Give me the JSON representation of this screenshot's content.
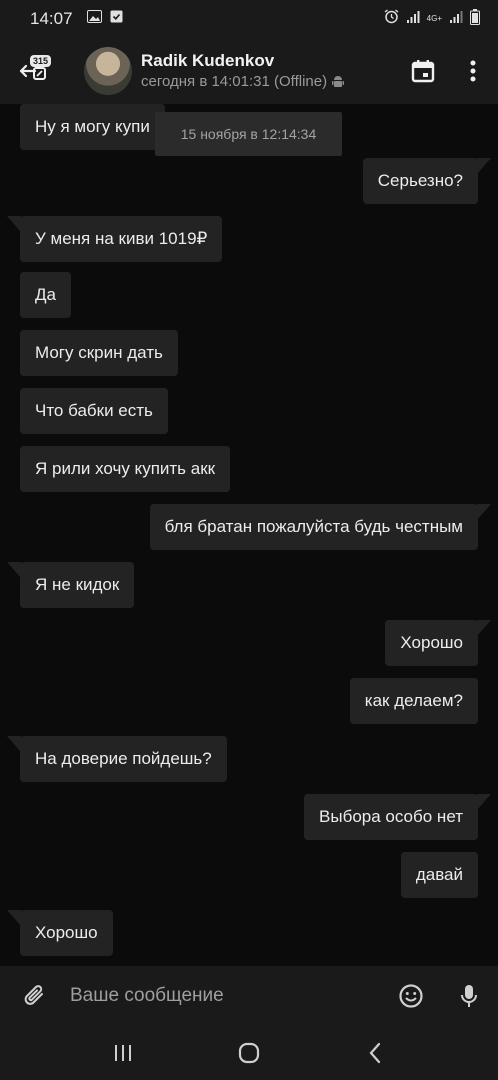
{
  "status_bar": {
    "time": "14:07",
    "network": "4G+"
  },
  "header": {
    "unread_count": "315",
    "contact_name": "Radik Kudenkov",
    "last_seen": "сегодня в 14:01:31 (Offline)"
  },
  "chat": {
    "date_tooltip": "15 ноября в 12:14:34",
    "messages": [
      {
        "dir": "in",
        "text": "Ну я могу купи"
      },
      {
        "dir": "out",
        "text": "Серьезно?"
      },
      {
        "dir": "in",
        "text": "У меня на киви 1019₽"
      },
      {
        "dir": "in",
        "text": "Да"
      },
      {
        "dir": "in",
        "text": "Могу скрин дать"
      },
      {
        "dir": "in",
        "text": "Что бабки есть"
      },
      {
        "dir": "in",
        "text": "Я рили хочу купить акк"
      },
      {
        "dir": "out",
        "text": "бля братан пожалуйста будь честным"
      },
      {
        "dir": "in",
        "text": "Я не кидок"
      },
      {
        "dir": "out",
        "text": "Хорошо"
      },
      {
        "dir": "out",
        "text": "как делаем?"
      },
      {
        "dir": "in",
        "text": "На доверие пойдешь?"
      },
      {
        "dir": "out",
        "text": "Выбора особо нет"
      },
      {
        "dir": "out",
        "text": "давай"
      },
      {
        "dir": "in",
        "text": "Хорошо"
      }
    ]
  },
  "composer": {
    "placeholder": "Ваше сообщение"
  },
  "colors": {
    "background": "#0b0b0b",
    "bar": "#1a1a1a",
    "bubble": "#232323"
  }
}
